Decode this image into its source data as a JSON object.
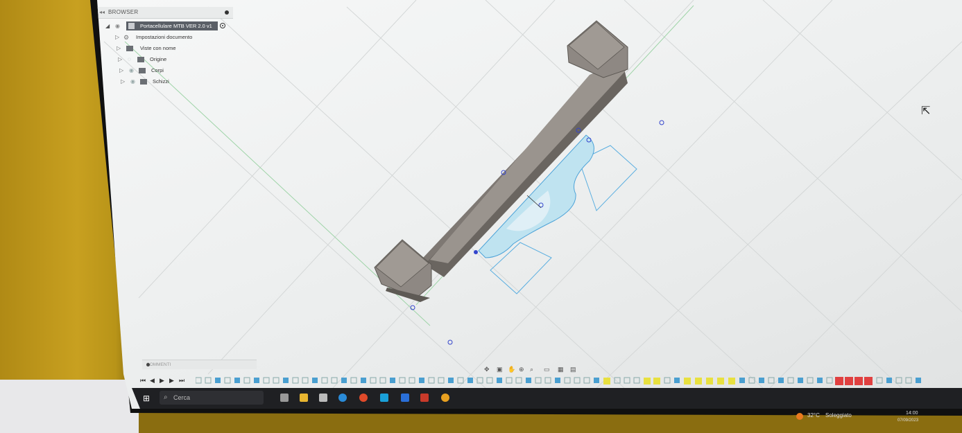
{
  "browser": {
    "title": "BROWSER",
    "root_label": "Portacellulare MTB VER 2.0 v1",
    "items": [
      {
        "label": "Impostazioni documento"
      },
      {
        "label": "Viste con nome"
      },
      {
        "label": "Origine"
      },
      {
        "label": "Corpi"
      },
      {
        "label": "Schizzi"
      }
    ]
  },
  "comments": {
    "label": "COMMENTI"
  },
  "taskbar": {
    "search_placeholder": "Cerca",
    "temperature": "32°C",
    "weather": "Soleggiato",
    "time": "14:00",
    "date": "07/09/2023"
  },
  "colors": {
    "wall": "#c8a020",
    "canvas": "#eef0f0",
    "model": "#8a8580",
    "sketch_fill": "#bfe3f0",
    "selection": "#4da3d8",
    "taskbar": "#1f2023"
  },
  "icons": {
    "cursor": "mouse-pointer-icon",
    "visibility": "eye-icon",
    "folder": "folder-icon"
  }
}
